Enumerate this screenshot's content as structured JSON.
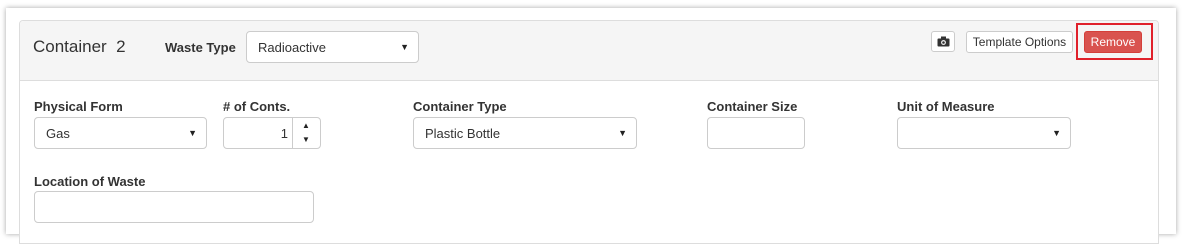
{
  "header": {
    "title": "Container  2",
    "waste_type_label": "Waste Type",
    "waste_type_value": "Radioactive",
    "camera_icon": "camera-icon",
    "template_options_label": "Template Options",
    "remove_label": "Remove"
  },
  "form": {
    "physical_form": {
      "label": "Physical Form",
      "value": "Gas"
    },
    "num_containers": {
      "label": "# of Conts.",
      "value": "1"
    },
    "container_type": {
      "label": "Container Type",
      "value": "Plastic Bottle"
    },
    "container_size": {
      "label": "Container Size",
      "value": ""
    },
    "unit_of_measure": {
      "label": "Unit of Measure",
      "value": ""
    },
    "location_of_waste": {
      "label": "Location of Waste",
      "value": ""
    }
  },
  "colors": {
    "danger": "#d9534f",
    "highlight_border": "#e0212b",
    "heading_bg": "#f5f5f5"
  }
}
